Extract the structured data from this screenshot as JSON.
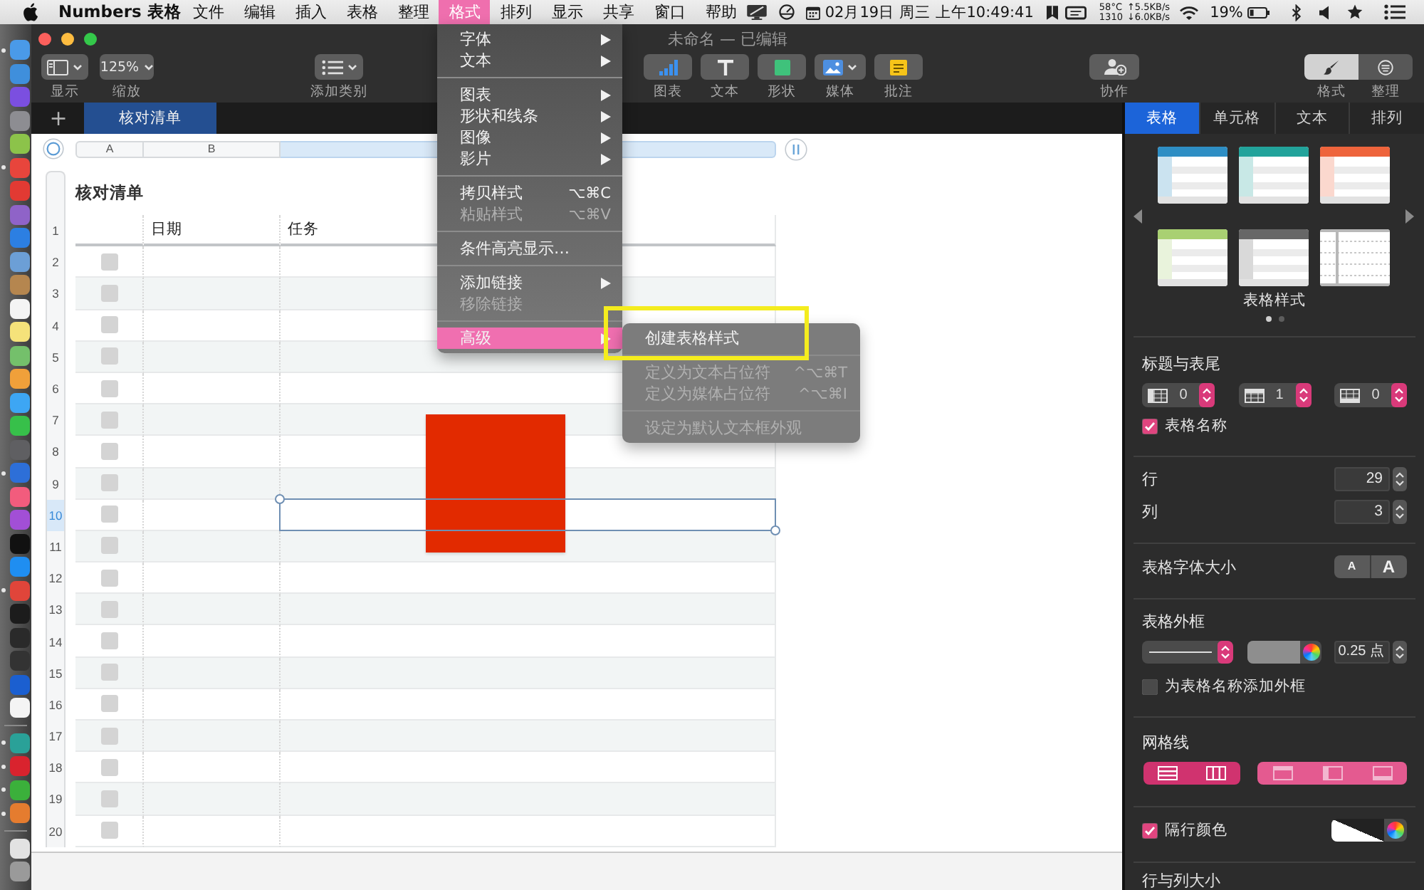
{
  "menubar": {
    "app_name": "Numbers 表格",
    "menus": [
      {
        "label": "文件",
        "selected": false
      },
      {
        "label": "编辑",
        "selected": false
      },
      {
        "label": "插入",
        "selected": false
      },
      {
        "label": "表格",
        "selected": false
      },
      {
        "label": "整理",
        "selected": false
      },
      {
        "label": "格式",
        "selected": true
      },
      {
        "label": "排列",
        "selected": false
      },
      {
        "label": "显示",
        "selected": false
      },
      {
        "label": "共享",
        "selected": false
      },
      {
        "label": "窗口",
        "selected": false
      },
      {
        "label": "帮助",
        "selected": false
      }
    ],
    "status": {
      "date": "02月19日 周三 上午10:49:41",
      "temperature": "58°C",
      "fan": "1310",
      "upload": "↑5.5KB/s",
      "download": "↓6.0KB/s",
      "battery": "19%"
    }
  },
  "dock": {
    "sections": [
      [
        {
          "color": "#4a9ae8",
          "running": true
        },
        {
          "color": "#3f8fdc",
          "running": false
        },
        {
          "color": "#7b4fe0",
          "running": false
        },
        {
          "color": "#8d8d92",
          "running": false
        },
        {
          "color": "#8cc34a",
          "running": false
        },
        {
          "color": "#e8453c",
          "running": true
        },
        {
          "color": "#e23a33",
          "running": false
        },
        {
          "color": "#8f63c8",
          "running": false
        },
        {
          "color": "#2c7fe2",
          "running": false
        },
        {
          "color": "#6c9fd6",
          "running": false
        },
        {
          "color": "#b5864f",
          "running": false
        },
        {
          "color": "#f4f4f4",
          "running": false
        },
        {
          "color": "#f5e27a",
          "running": false
        },
        {
          "color": "#74c06b",
          "running": false
        },
        {
          "color": "#f0a03a",
          "running": false
        },
        {
          "color": "#3da6f4",
          "running": false
        },
        {
          "color": "#37c04a",
          "running": false
        },
        {
          "color": "#5f5f62",
          "running": false
        },
        {
          "color": "#2d6fd8",
          "running": true
        },
        {
          "color": "#f25c7d",
          "running": false
        },
        {
          "color": "#a24fd6",
          "running": false
        },
        {
          "color": "#111111",
          "running": false
        },
        {
          "color": "#1f8ef1",
          "running": false
        },
        {
          "color": "#e0453a",
          "running": true
        },
        {
          "color": "#1c1c1c",
          "running": false
        },
        {
          "color": "#2a2a2a",
          "running": false
        },
        {
          "color": "#333333",
          "running": false
        },
        {
          "color": "#1b5fd0",
          "running": false
        },
        {
          "color": "#f4f4f4",
          "running": false
        }
      ],
      [
        {
          "color": "#2aa198",
          "running": true
        },
        {
          "color": "#d9232e",
          "running": true
        },
        {
          "color": "#3bb03b",
          "running": true
        },
        {
          "color": "#e57c2f",
          "running": true
        }
      ],
      [
        {
          "color": "#e2e2e2",
          "running": false
        },
        {
          "color": "#9a9a9a",
          "running": false
        }
      ]
    ]
  },
  "window": {
    "title": "未命名 — 已编辑"
  },
  "toolbar": {
    "groups": [
      [
        {
          "kind": "view",
          "label": "显示",
          "caret": true
        },
        {
          "kind": "zoom",
          "value": "125%",
          "label": "缩放",
          "caret": true
        }
      ],
      [
        {
          "kind": "category",
          "label": "添加类别",
          "caret": true
        }
      ],
      [
        {
          "kind": "chart",
          "label": "图表",
          "caret": false
        },
        {
          "kind": "text",
          "label": "文本",
          "caret": false
        },
        {
          "kind": "shape",
          "label": "形状",
          "caret": false
        },
        {
          "kind": "media",
          "label": "媒体",
          "caret": true
        },
        {
          "kind": "comment",
          "label": "批注",
          "caret": false
        }
      ],
      [
        {
          "kind": "collaborate",
          "label": "协作",
          "caret": false
        }
      ]
    ],
    "inspector_switch": [
      {
        "kind": "format",
        "label": "格式",
        "selected": true
      },
      {
        "kind": "arrange",
        "label": "整理",
        "selected": false
      }
    ]
  },
  "sheets": {
    "add": "+",
    "tabs": [
      {
        "label": "核对清单",
        "selected": true
      }
    ]
  },
  "table": {
    "title": "核对清单",
    "columns": [
      {
        "label": "A",
        "selected": false
      },
      {
        "label": "B",
        "selected": false
      },
      {
        "selected": true
      }
    ],
    "header_row": {
      "number": "1",
      "labels": [
        "日期",
        "任务"
      ]
    },
    "rows": [
      {
        "number": "2",
        "checked": false,
        "selected": false
      },
      {
        "number": "3",
        "checked": false,
        "selected": false
      },
      {
        "number": "4",
        "checked": false,
        "selected": false
      },
      {
        "number": "5",
        "checked": false,
        "selected": false
      },
      {
        "number": "6",
        "checked": false,
        "selected": false
      },
      {
        "number": "7",
        "checked": false,
        "selected": false
      },
      {
        "number": "8",
        "checked": false,
        "selected": false
      },
      {
        "number": "9",
        "checked": false,
        "selected": false
      },
      {
        "number": "10",
        "checked": false,
        "selected": true
      },
      {
        "number": "11",
        "checked": false,
        "selected": false
      },
      {
        "number": "12",
        "checked": false,
        "selected": false
      },
      {
        "number": "13",
        "checked": false,
        "selected": false
      },
      {
        "number": "14",
        "checked": false,
        "selected": false
      },
      {
        "number": "15",
        "checked": false,
        "selected": false
      },
      {
        "number": "16",
        "checked": false,
        "selected": false
      },
      {
        "number": "17",
        "checked": false,
        "selected": false
      },
      {
        "number": "18",
        "checked": false,
        "selected": false
      },
      {
        "number": "19",
        "checked": false,
        "selected": false
      },
      {
        "number": "20",
        "checked": false,
        "selected": false
      }
    ]
  },
  "canvas": {
    "shapes": [
      {
        "kind": "rectangle",
        "color": "#e22a00"
      }
    ]
  },
  "format_menu": {
    "items": [
      {
        "kind": "item",
        "label": "字体",
        "submenu": true,
        "disabled": false,
        "selected": false
      },
      {
        "kind": "item",
        "label": "文本",
        "submenu": true,
        "disabled": false,
        "selected": false
      },
      {
        "kind": "separator"
      },
      {
        "kind": "item",
        "label": "图表",
        "submenu": true,
        "disabled": false,
        "selected": false
      },
      {
        "kind": "item",
        "label": "形状和线条",
        "submenu": true,
        "disabled": false,
        "selected": false
      },
      {
        "kind": "item",
        "label": "图像",
        "submenu": true,
        "disabled": false,
        "selected": false
      },
      {
        "kind": "item",
        "label": "影片",
        "submenu": true,
        "disabled": false,
        "selected": false
      },
      {
        "kind": "separator"
      },
      {
        "kind": "item",
        "label": "拷贝样式",
        "shortcut": "⌥⌘C",
        "submenu": false,
        "disabled": false,
        "selected": false
      },
      {
        "kind": "item",
        "label": "粘贴样式",
        "shortcut": "⌥⌘V",
        "submenu": false,
        "disabled": true,
        "selected": false
      },
      {
        "kind": "separator"
      },
      {
        "kind": "item",
        "label": "条件高亮显示…",
        "submenu": false,
        "disabled": false,
        "selected": false
      },
      {
        "kind": "separator"
      },
      {
        "kind": "item",
        "label": "添加链接",
        "submenu": true,
        "disabled": false,
        "selected": false
      },
      {
        "kind": "item",
        "label": "移除链接",
        "submenu": false,
        "disabled": true,
        "selected": false
      },
      {
        "kind": "separator"
      },
      {
        "kind": "item",
        "label": "高级",
        "submenu": true,
        "disabled": false,
        "selected": true
      }
    ]
  },
  "advanced_submenu": {
    "items": [
      {
        "kind": "item",
        "label": "创建表格样式",
        "disabled": false,
        "annotated": true
      },
      {
        "kind": "separator"
      },
      {
        "kind": "item",
        "label": "定义为文本占位符",
        "shortcut": "^⌥⌘T",
        "disabled": true,
        "annotated": false
      },
      {
        "kind": "item",
        "label": "定义为媒体占位符",
        "shortcut": "^⌥⌘I",
        "disabled": true,
        "annotated": false
      },
      {
        "kind": "separator"
      },
      {
        "kind": "item",
        "label": "设定为默认文本框外观",
        "disabled": true,
        "annotated": false
      }
    ]
  },
  "inspector": {
    "tabs": [
      {
        "label": "表格",
        "selected": true
      },
      {
        "label": "单元格",
        "selected": false
      },
      {
        "label": "文本",
        "selected": false
      },
      {
        "label": "排列",
        "selected": false
      }
    ],
    "styles": {
      "items": [
        {
          "kind": "header",
          "color": "#2e8ec4"
        },
        {
          "kind": "header",
          "color": "#22a39b"
        },
        {
          "kind": "header",
          "color": "#ee643c"
        },
        {
          "kind": "header",
          "color": "#a9d072"
        },
        {
          "kind": "header",
          "color": "#676767"
        },
        {
          "kind": "plain",
          "color": "#b8b8b8"
        }
      ],
      "label": "表格样式",
      "pages": [
        {
          "selected": true
        },
        {
          "selected": false
        }
      ]
    },
    "header_footer": {
      "label": "标题与表尾",
      "controls": [
        {
          "kind": "header_columns",
          "value": "0"
        },
        {
          "kind": "header_rows",
          "value": "1"
        },
        {
          "kind": "footer_rows",
          "value": "0"
        }
      ],
      "title_option": {
        "label": "表格名称",
        "checked": true
      }
    },
    "size": [
      {
        "label": "行",
        "value": "29"
      },
      {
        "label": "列",
        "value": "3"
      }
    ],
    "font_size": {
      "label": "表格字体大小",
      "buttons": [
        "A",
        "A"
      ]
    },
    "outline": {
      "label": "表格外框",
      "width": "0.25 点",
      "title_option": {
        "label": "为表格名称添加外框",
        "checked": false
      }
    },
    "gridlines": {
      "label": "网格线",
      "groups": [
        [
          {
            "kind": "inner_horizontal",
            "on": true
          },
          {
            "kind": "inner_vertical",
            "on": true
          }
        ],
        [
          {
            "kind": "header_rows",
            "on": false
          },
          {
            "kind": "header_columns",
            "on": false
          },
          {
            "kind": "footer_rows",
            "on": false
          }
        ]
      ]
    },
    "alternating": {
      "label": "隔行颜色",
      "checked": true
    },
    "next_section": {
      "label": "行与列大小"
    }
  }
}
